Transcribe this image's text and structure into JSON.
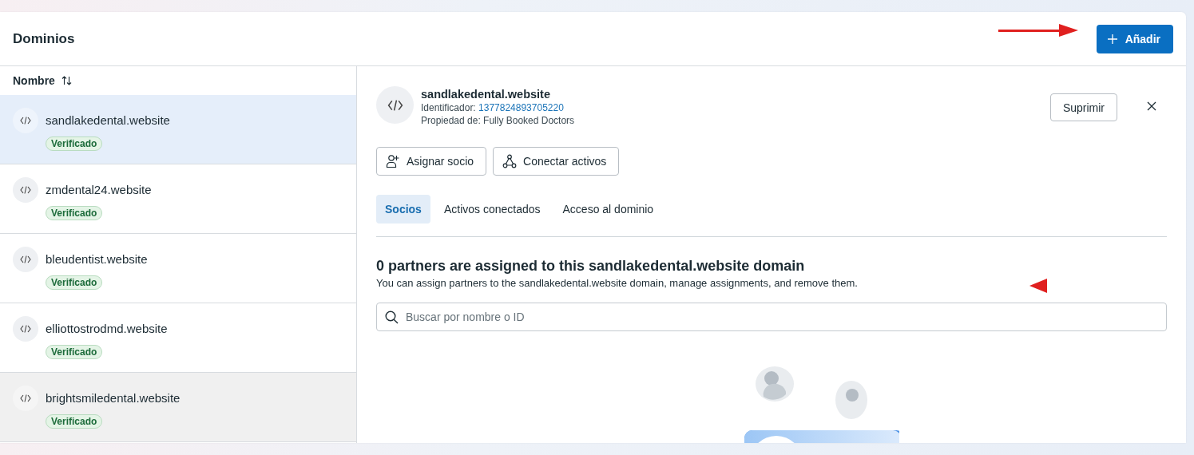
{
  "header": {
    "title": "Dominios",
    "add_button": "Añadir"
  },
  "list": {
    "column": "Nombre",
    "items": [
      {
        "name": "sandlakedental.website",
        "status": "Verificado",
        "selected": true,
        "hovered": false
      },
      {
        "name": "zmdental24.website",
        "status": "Verificado",
        "selected": false,
        "hovered": false
      },
      {
        "name": "bleudentist.website",
        "status": "Verificado",
        "selected": false,
        "hovered": false
      },
      {
        "name": "elliottostrodmd.website",
        "status": "Verificado",
        "selected": false,
        "hovered": false
      },
      {
        "name": "brightsmiledental.website",
        "status": "Verificado",
        "selected": false,
        "hovered": true
      }
    ]
  },
  "detail": {
    "name": "sandlakedental.website",
    "id_label": "Identificador:",
    "id_value": "1377824893705220",
    "owner": "Propiedad de: Fully Booked Doctors",
    "delete_button": "Suprimir",
    "actions": [
      {
        "label": "Asignar socio",
        "kind": "assign"
      },
      {
        "label": "Conectar activos",
        "kind": "connect"
      }
    ],
    "tabs": [
      {
        "label": "Socios",
        "selected": true
      },
      {
        "label": "Activos conectados",
        "selected": false
      },
      {
        "label": "Acceso al dominio",
        "selected": false
      }
    ],
    "heading": "0 partners are assigned to this sandlakedental.website domain",
    "description": "You can assign partners to the sandlakedental.website domain, manage assignments, and remove them.",
    "search": {
      "placeholder": "Buscar por nombre o ID"
    }
  }
}
